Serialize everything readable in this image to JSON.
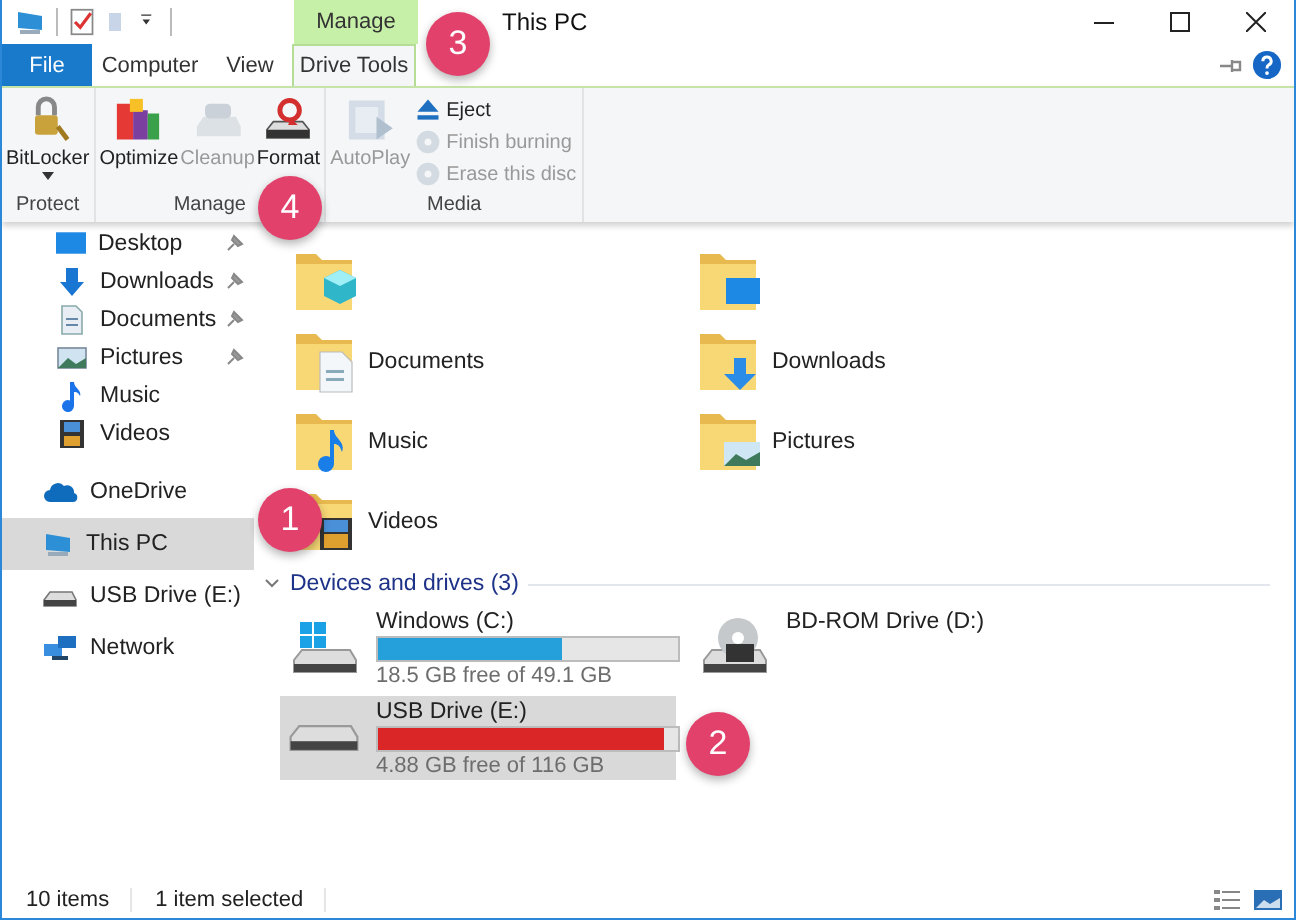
{
  "window": {
    "title": "This PC"
  },
  "context_tab": {
    "label": "Manage"
  },
  "tabs": [
    {
      "label": "File",
      "kind": "file",
      "selected": false
    },
    {
      "label": "Computer",
      "kind": "normal",
      "selected": false
    },
    {
      "label": "View",
      "kind": "normal",
      "selected": false
    },
    {
      "label": "Drive Tools",
      "kind": "context",
      "selected": true
    }
  ],
  "ribbon": {
    "groups": [
      {
        "label": "Protect",
        "buttons": [
          {
            "label": "BitLocker",
            "kind": "large",
            "dropdown": true,
            "disabled": false
          }
        ]
      },
      {
        "label": "Manage",
        "buttons": [
          {
            "label": "Optimize",
            "kind": "large",
            "disabled": false
          },
          {
            "label": "Cleanup",
            "kind": "large",
            "disabled": true
          },
          {
            "label": "Format",
            "kind": "large",
            "disabled": false
          }
        ]
      },
      {
        "label": "Media",
        "buttons": [
          {
            "label": "AutoPlay",
            "kind": "large",
            "disabled": true
          },
          {
            "label": "Eject",
            "kind": "small",
            "disabled": false
          },
          {
            "label": "Finish burning",
            "kind": "small",
            "disabled": true
          },
          {
            "label": "Erase this disc",
            "kind": "small",
            "disabled": true
          }
        ]
      }
    ]
  },
  "sidebar": {
    "items": [
      {
        "label": "Desktop",
        "kind": "desktop",
        "pinned": true,
        "selected": false
      },
      {
        "label": "Downloads",
        "kind": "downloads",
        "pinned": true,
        "selected": false
      },
      {
        "label": "Documents",
        "kind": "documents",
        "pinned": true,
        "selected": false
      },
      {
        "label": "Pictures",
        "kind": "pictures",
        "pinned": true,
        "selected": false
      },
      {
        "label": "Music",
        "kind": "music",
        "pinned": false,
        "selected": false
      },
      {
        "label": "Videos",
        "kind": "videos",
        "pinned": false,
        "selected": false
      }
    ],
    "locations": [
      {
        "label": "OneDrive",
        "kind": "onedrive",
        "selected": false
      },
      {
        "label": "This PC",
        "kind": "pc",
        "selected": true
      },
      {
        "label": "USB Drive (E:)",
        "kind": "usb",
        "selected": false
      },
      {
        "label": "Network",
        "kind": "network",
        "selected": false
      }
    ]
  },
  "folders": [
    {
      "kind": "objects"
    },
    {
      "kind": "desktop"
    },
    {
      "label": "Documents",
      "kind": "documents"
    },
    {
      "label": "Downloads",
      "kind": "downloads"
    },
    {
      "label": "Music",
      "kind": "music"
    },
    {
      "label": "Pictures",
      "kind": "pictures"
    },
    {
      "label": "Videos",
      "kind": "videos"
    }
  ],
  "drives_section": {
    "title": "Devices and drives (3)",
    "expanded": true
  },
  "drives": [
    {
      "name": "Windows (C:)",
      "kind": "system",
      "level": 0.615,
      "free": "18.5 GB free of 49.1 GB",
      "low_space": false,
      "selected": false
    },
    {
      "name": "BD-ROM Drive (D:)",
      "kind": "optical",
      "selected": false
    },
    {
      "name": "USB Drive (E:)",
      "kind": "usb",
      "level": 0.956,
      "free": "4.88 GB free of 116 GB",
      "low_space": true,
      "selected": true
    }
  ],
  "status_bar": {
    "items": "10 items",
    "selection": "1 item selected"
  },
  "callouts": [
    {
      "number": "1"
    },
    {
      "number": "2"
    },
    {
      "number": "3"
    },
    {
      "number": "4"
    }
  ]
}
